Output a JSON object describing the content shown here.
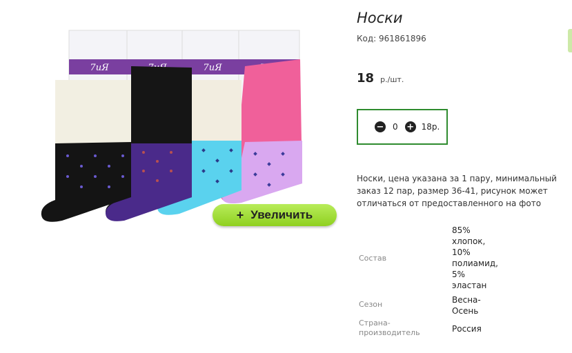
{
  "product": {
    "title": "Носки",
    "code": "Код: 961861896",
    "price": "18",
    "price_unit": "р./шт."
  },
  "image": {
    "brand_text": "7иЯ",
    "zoom_label": "Увеличить",
    "zoom_icon": "+"
  },
  "quantity": {
    "minus_icon": "−",
    "plus_icon": "+",
    "value": "0",
    "total": "18р."
  },
  "description": "Носки, цена указана за 1 пару, минимальный заказ 12 пар, размер 36-41, рисунок может отличаться от предоставленного на фото",
  "specs": {
    "composition_label": "Состав",
    "composition_value": "85% хлопок, 10% полиамид, 5% эластан",
    "season_label": "Сезон",
    "season_value": "Весна-Осень",
    "country_label": "Страна-производитель",
    "country_value": "Россия"
  },
  "colors": {
    "accent_green": "#2e8b2e",
    "zoom_button": "#a6e03a"
  }
}
